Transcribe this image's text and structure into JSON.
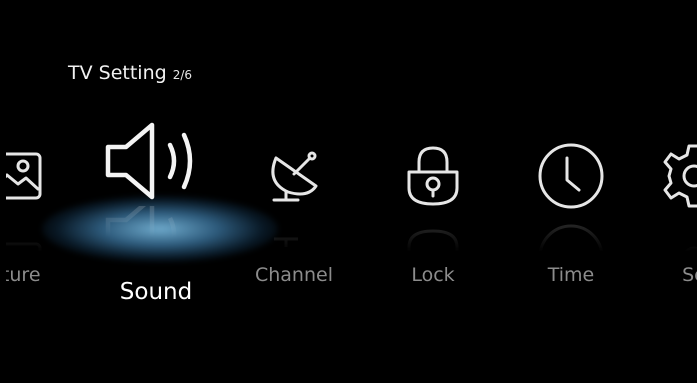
{
  "header": {
    "title": "TV Setting",
    "page_indicator": "2/6"
  },
  "menu": {
    "selected_index": 1,
    "items": [
      {
        "label": "Picture",
        "visible_label": "cture",
        "icon": "picture-icon"
      },
      {
        "label": "Sound",
        "visible_label": "Sound",
        "icon": "speaker-icon"
      },
      {
        "label": "Channel",
        "visible_label": "Channel",
        "icon": "satellite-dish-icon"
      },
      {
        "label": "Lock",
        "visible_label": "Lock",
        "icon": "padlock-icon"
      },
      {
        "label": "Time",
        "visible_label": "Time",
        "icon": "clock-icon"
      },
      {
        "label": "Setup",
        "visible_label": "Se",
        "icon": "gear-icon"
      }
    ]
  },
  "colors": {
    "background": "#000000",
    "selected_text": "#ffffff",
    "unselected_text": "#8c8c8c",
    "highlight_glow": "#64aee0"
  }
}
